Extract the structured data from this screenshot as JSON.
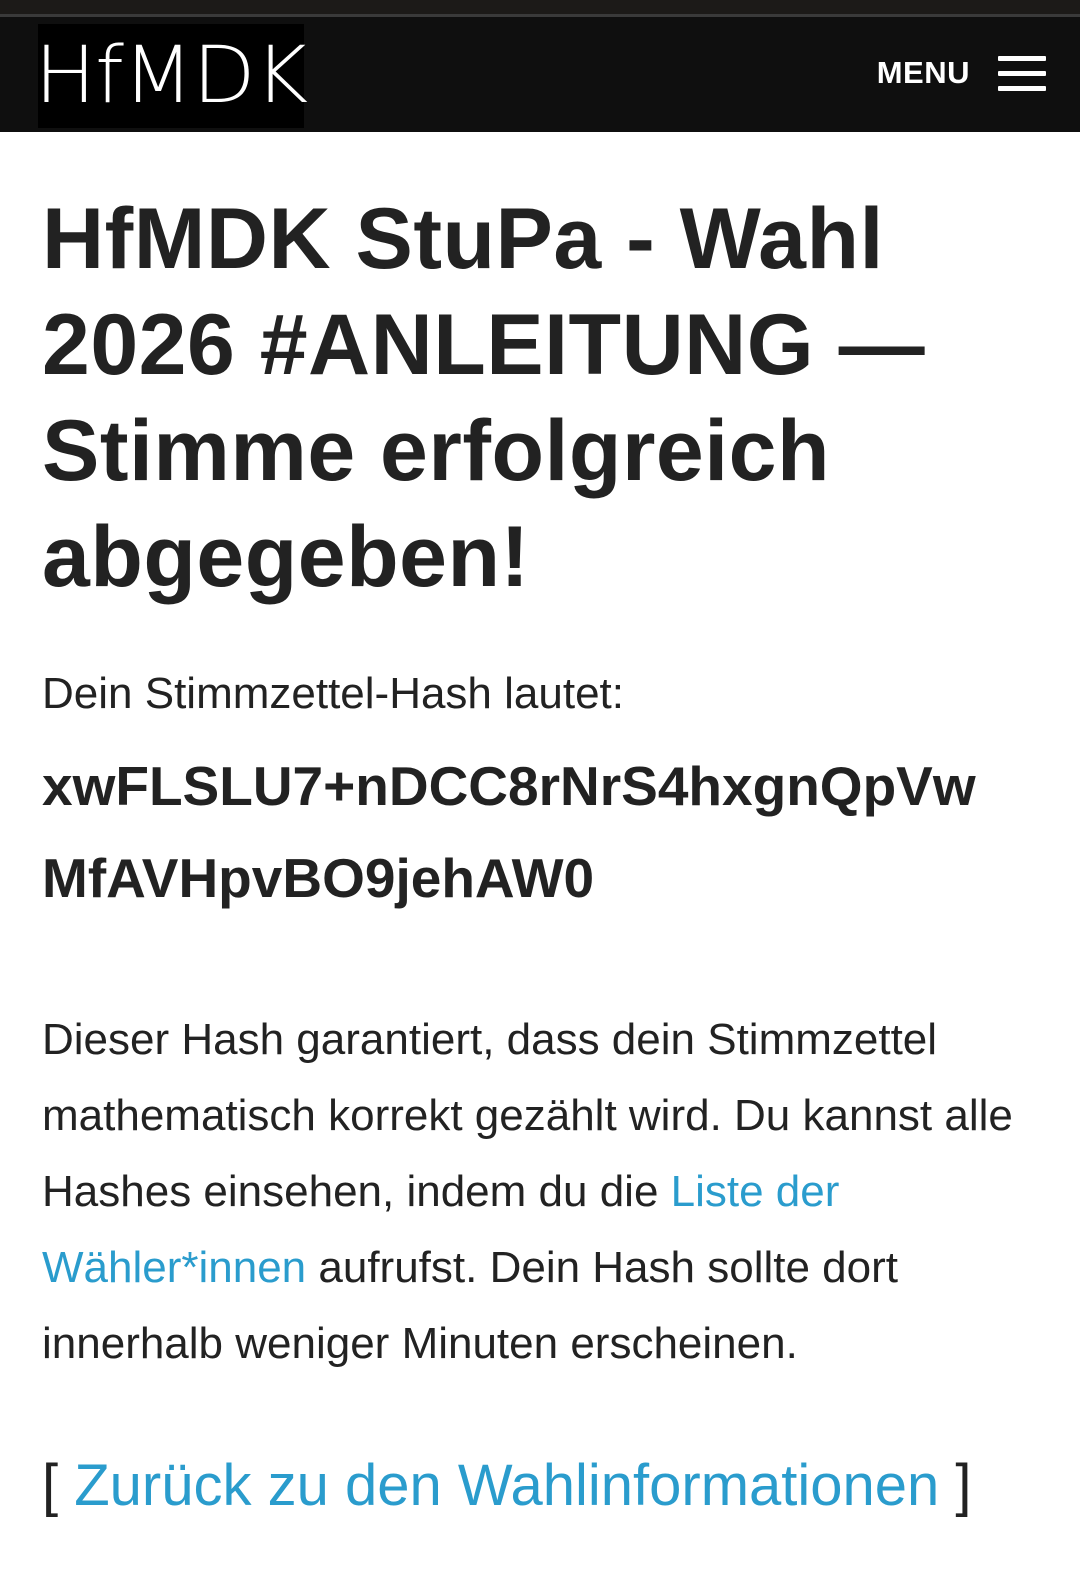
{
  "header": {
    "logo_text": "HfMDK",
    "menu_label": "MENU",
    "menu_icon": "hamburger-menu-icon",
    "background_color": "#0f0f0f"
  },
  "page": {
    "title": "HfMDK StuPa - Wahl 2026 #ANLEITUNG — Stimme erfolgreich abgegeben!",
    "hash_label": "Dein Stimmzettel-Hash lautet:",
    "hash_value": "xwFLSLU7+nDCC8rNrS4hxgnQpVwMfAVHpvBO9jehAW0",
    "body": {
      "part1": "Dieser Hash garantiert, dass dein Stimmzettel mathematisch korrekt gezählt wird. Du kannst alle Hashes einsehen, indem du die ",
      "link_text": "Liste der Wähler*innen",
      "part2": " aufrufst. Dein Hash sollte dort innerhalb weniger Minuten erscheinen."
    },
    "back": {
      "open_bracket": "[",
      "link_text": "Zurück zu den Wahlinformationen",
      "close_bracket": "]"
    }
  },
  "colors": {
    "link": "#2a9ccd",
    "text": "#222222",
    "background": "#ffffff"
  }
}
